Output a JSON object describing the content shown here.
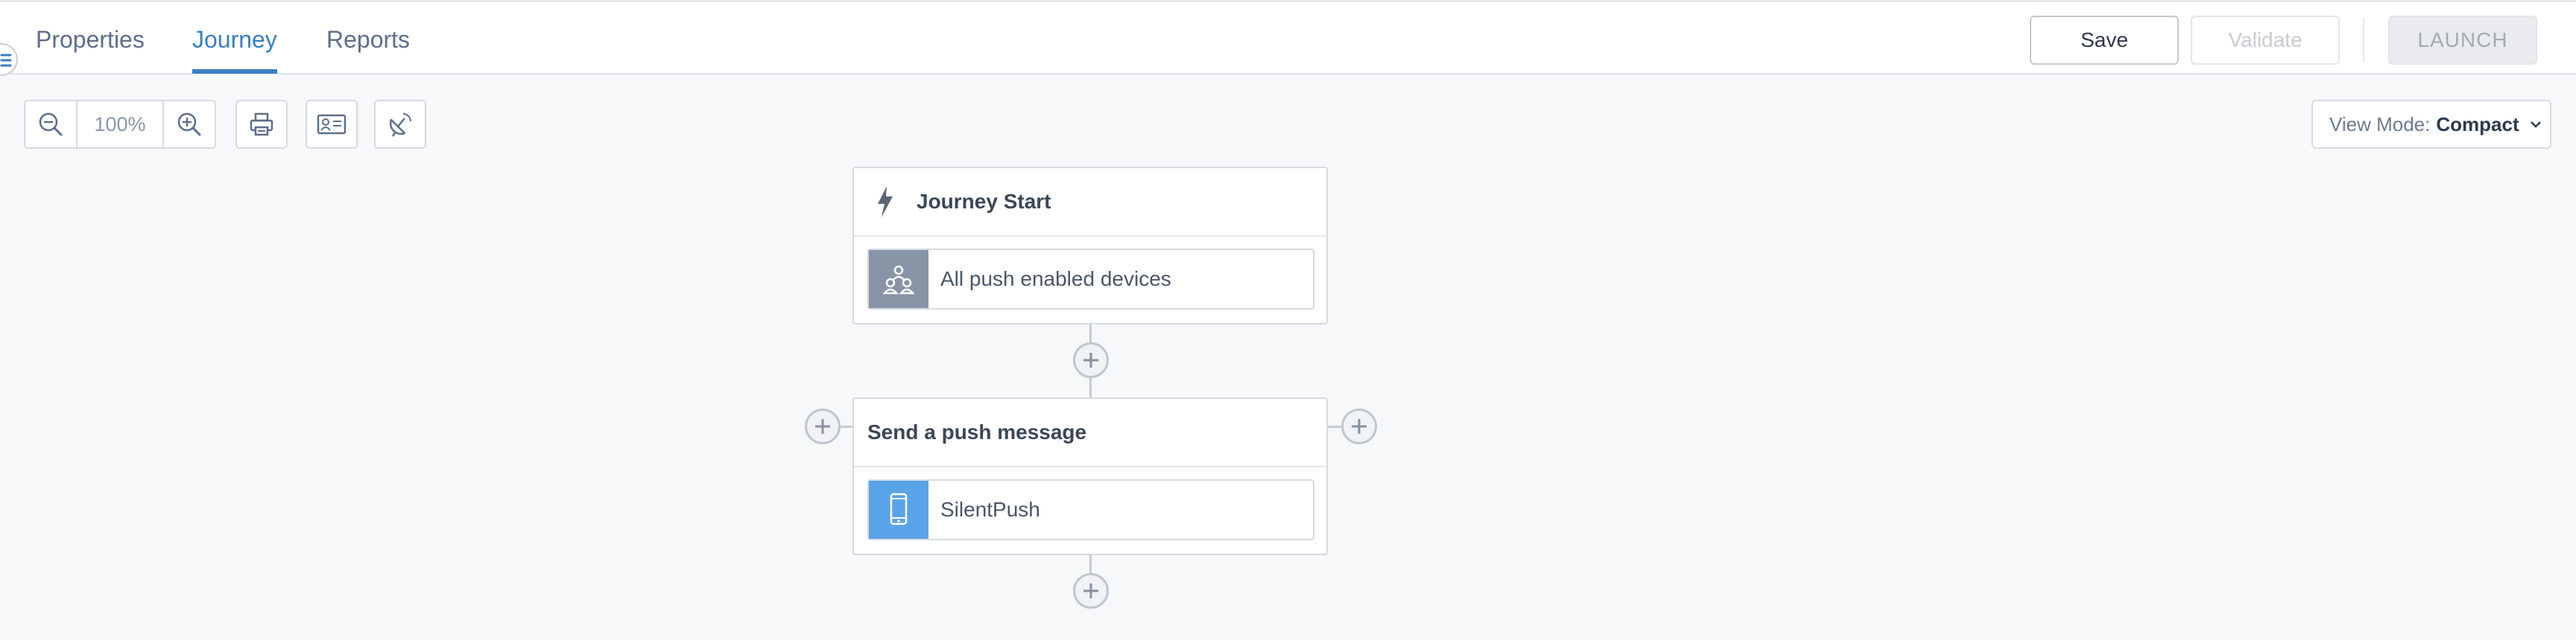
{
  "tabs": [
    {
      "label": "Properties",
      "active": false
    },
    {
      "label": "Journey",
      "active": true
    },
    {
      "label": "Reports",
      "active": false
    }
  ],
  "actions": {
    "save_label": "Save",
    "validate_label": "Validate",
    "launch_label": "LAUNCH"
  },
  "toolbar": {
    "zoom_value": "100%",
    "icons": [
      "zoom-out-icon",
      "zoom-in-icon",
      "print-icon",
      "contact-card-icon",
      "satellite-dish-icon"
    ]
  },
  "view_mode": {
    "label": "View Mode:",
    "value": "Compact"
  },
  "journey": {
    "start": {
      "title": "Journey Start",
      "item_label": "All push enabled devices",
      "item_icon": "audience-icon"
    },
    "step": {
      "title": "Send a push message",
      "item_label": "SilentPush",
      "item_icon": "mobile-phone-icon"
    }
  },
  "colors": {
    "accent": "#3a7fc1",
    "audience_icon_bg": "#8794a6",
    "push_icon_bg": "#5aa3e8"
  }
}
